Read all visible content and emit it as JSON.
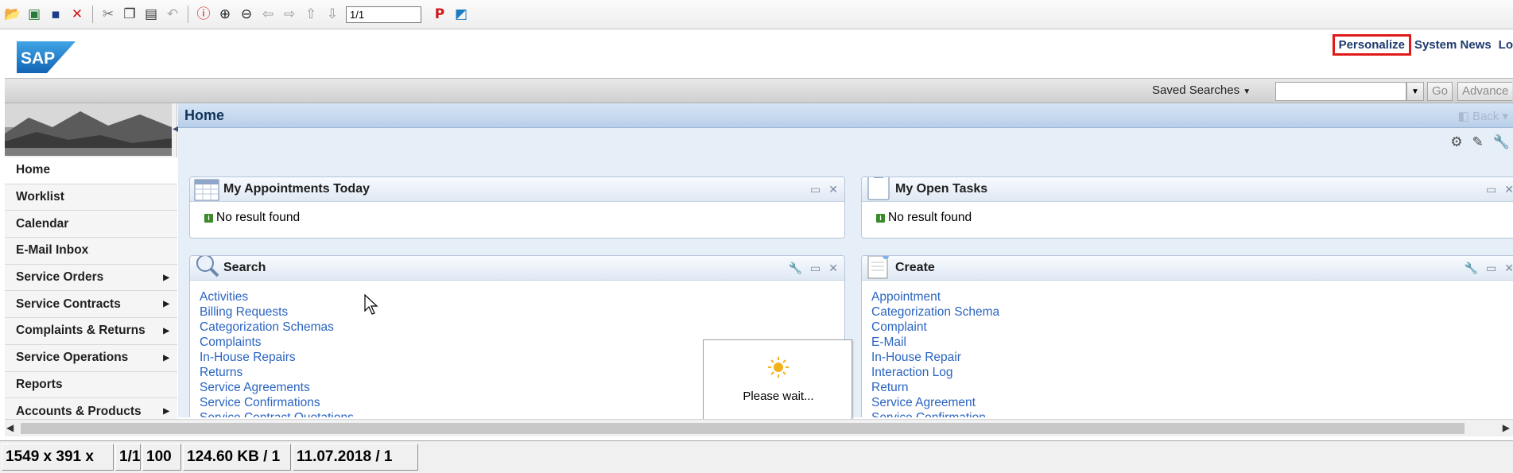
{
  "viewer_toolbar": {
    "page_field": "1/1",
    "icons": [
      "open-folder-icon",
      "image-icon",
      "save-icon",
      "delete-icon",
      "cut-icon",
      "copy-icon",
      "paste-icon",
      "undo-icon",
      "info-icon",
      "zoom-in-icon",
      "zoom-out-icon",
      "arrow-left-icon",
      "arrow-right-icon",
      "page-up-icon",
      "page-down-icon",
      "p-icon",
      "color-icon"
    ]
  },
  "header": {
    "logo_text": "SAP",
    "links": [
      "Personalize",
      "System News",
      "Lo"
    ]
  },
  "search_bar": {
    "saved_searches_label": "Saved Searches",
    "go_label": "Go",
    "advanced_label": "Advance"
  },
  "nav": {
    "items": [
      {
        "label": "Home",
        "arrow": false
      },
      {
        "label": "Worklist",
        "arrow": false
      },
      {
        "label": "Calendar",
        "arrow": false
      },
      {
        "label": "E-Mail Inbox",
        "arrow": false
      },
      {
        "label": "Service Orders",
        "arrow": true
      },
      {
        "label": "Service Contracts",
        "arrow": true
      },
      {
        "label": "Complaints & Returns",
        "arrow": true
      },
      {
        "label": "Service Operations",
        "arrow": true
      },
      {
        "label": "Reports",
        "arrow": false
      },
      {
        "label": "Accounts & Products",
        "arrow": true
      }
    ]
  },
  "main": {
    "title": "Home",
    "back_label": "Back",
    "appointments": {
      "title": "My Appointments Today",
      "message": "No result found"
    },
    "tasks": {
      "title": "My Open Tasks",
      "message": "No result found"
    },
    "search": {
      "title": "Search",
      "links": [
        "Activities",
        "Billing Requests",
        "Categorization Schemas",
        "Complaints",
        "In-House Repairs",
        "Returns",
        "Service Agreements",
        "Service Confirmations",
        "Service Contract Quotations"
      ]
    },
    "create": {
      "title": "Create",
      "links": [
        "Appointment",
        "Categorization Schema",
        "Complaint",
        "E-Mail",
        "In-House Repair",
        "Interaction Log",
        "Return",
        "Service Agreement",
        "Service Confirmation"
      ]
    },
    "wait_text": "Please wait..."
  },
  "status_bar": {
    "cells": [
      "1549 x 391 x",
      "1/1",
      "100",
      "124.60 KB / 1",
      "11.07.2018 / 1"
    ]
  },
  "colors": {
    "link": "#2a64c2",
    "title": "#12325b",
    "highlight": "#e01919"
  }
}
